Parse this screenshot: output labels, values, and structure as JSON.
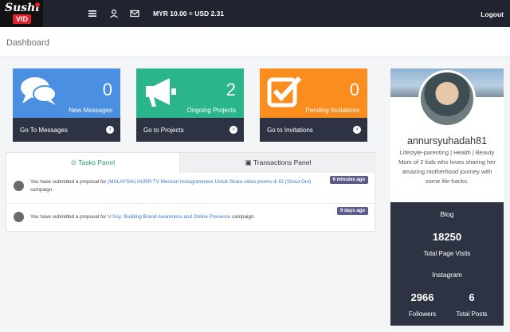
{
  "topbar": {
    "logo_text": "Sushi",
    "logo_sub": "VID",
    "rate": "MYR 10.00 = USD 2.31",
    "logout": "Logout",
    "icons": [
      "menu-icon",
      "user-icon",
      "envelope-icon"
    ]
  },
  "page": {
    "title": "Dashboard"
  },
  "cards": [
    {
      "count": "0",
      "label": "New Messages",
      "link": "Go To Messages",
      "color": "#4b8fe2",
      "icon": "chat-bubbles-icon"
    },
    {
      "count": "2",
      "label": "Ongoing Projects",
      "link": "Go to Projects",
      "color": "#2bb58a",
      "icon": "megaphone-icon"
    },
    {
      "count": "0",
      "label": "Pending Invitations",
      "link": "Go to Invitations",
      "color": "#fb8c1e",
      "icon": "checkbox-icon"
    }
  ],
  "tabs": {
    "tasks": "Tasks Panel",
    "transactions": "Transactions Panel"
  },
  "tasks": [
    {
      "prefix": "You have submitted a proposal for",
      "link": "(MALAYSIA) HURR TV Mencari Instagrammers Untuk Share video promo di IG (Shout Out)",
      "suffix": "campaign.",
      "time": "6 minutes ago"
    },
    {
      "prefix": "You have submitted a proposal for",
      "link": "V-Soy: Building Brand Awareness and Online Presence",
      "suffix": "campaign.",
      "time": "9 days ago"
    }
  ],
  "profile": {
    "username": "annursyuhadah81",
    "bio": "Lifestyle-parenting | Health | Beauty Mom of 2 kids who loves sharing her amazing motherhood journey with some life-hacks.",
    "blog_heading": "Blog",
    "page_visits": "18250",
    "page_visits_label": "Total Page Visits",
    "instagram_heading": "Instagram",
    "followers": "2966",
    "followers_label": "Followers",
    "posts": "6",
    "posts_label": "Total Posts"
  }
}
